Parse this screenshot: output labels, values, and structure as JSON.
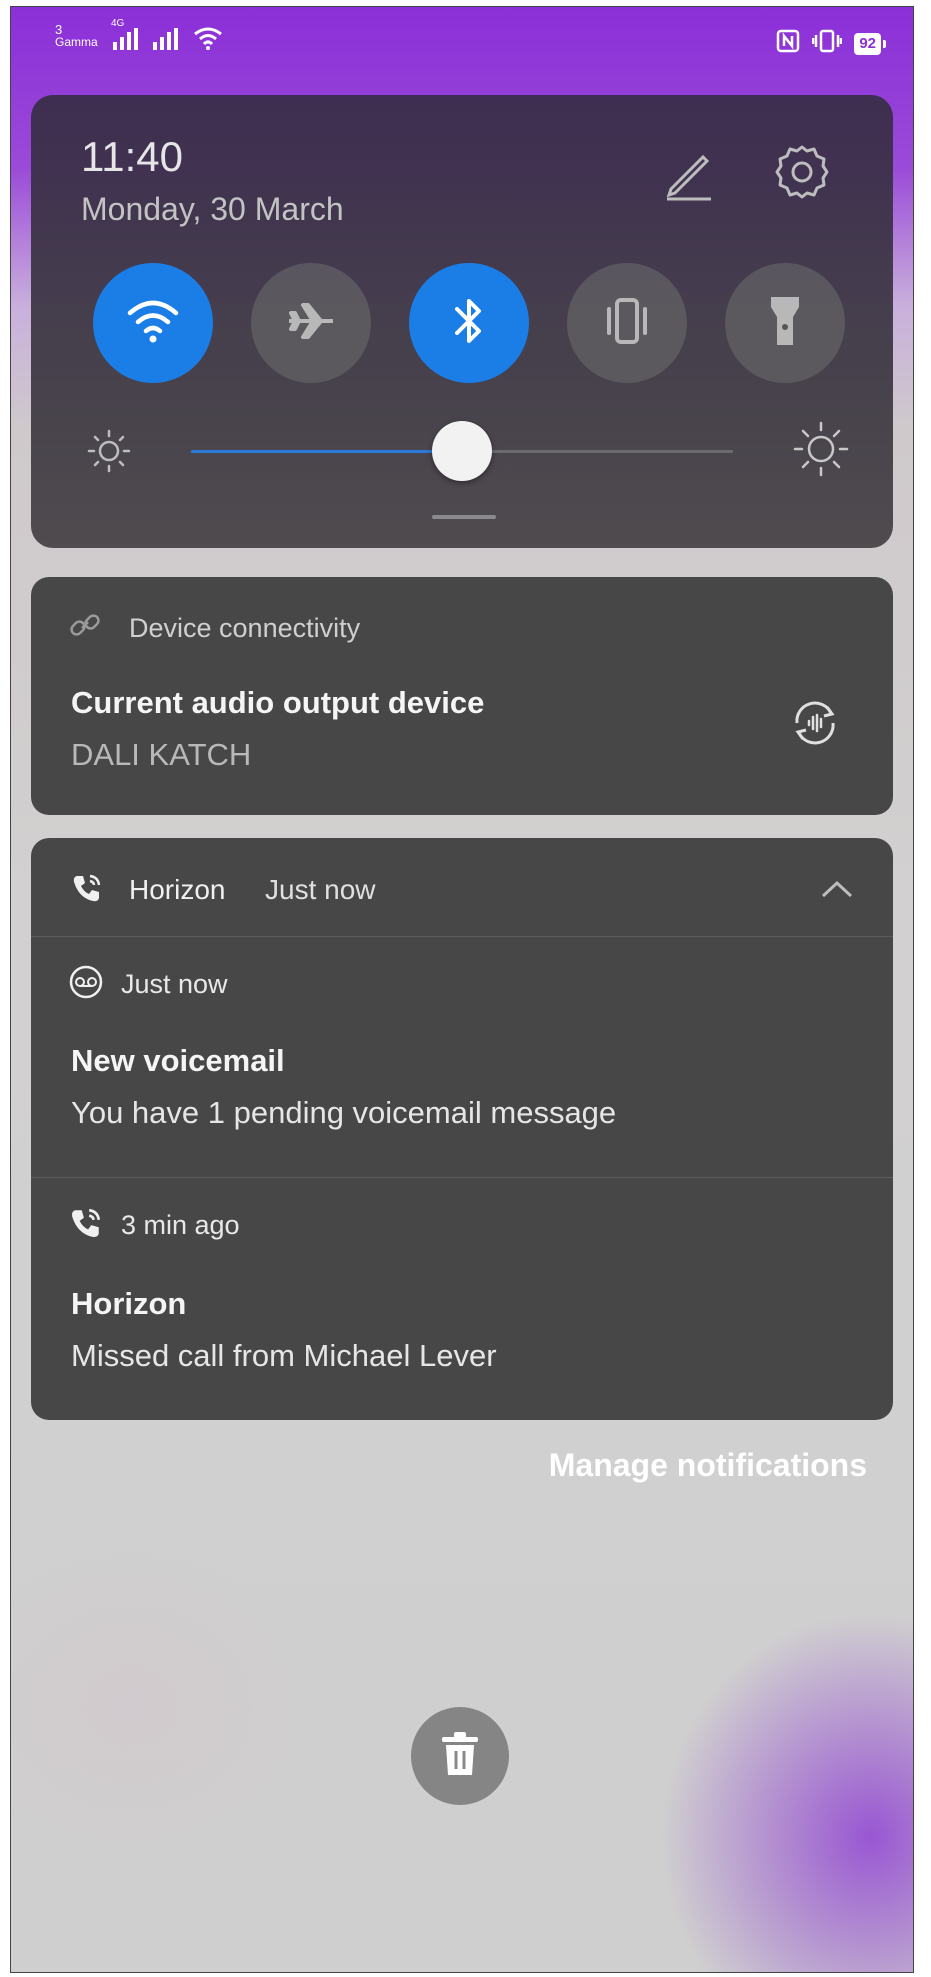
{
  "status_bar": {
    "carrier_number": "3",
    "carrier_name": "Gamma",
    "network_type": "4G",
    "battery_level": "92",
    "icons_left": [
      "signal-icon",
      "signal-icon",
      "wifi-icon"
    ],
    "icons_right": [
      "nfc-icon",
      "vibrate-icon",
      "battery-icon"
    ]
  },
  "quick_settings": {
    "time": "11:40",
    "date": "Monday, 30 March",
    "toggles": [
      {
        "name": "wifi",
        "icon": "wifi-icon",
        "on": true
      },
      {
        "name": "airplane",
        "icon": "airplane-icon",
        "on": false
      },
      {
        "name": "bluetooth",
        "icon": "bluetooth-icon",
        "on": true
      },
      {
        "name": "vibrate",
        "icon": "vibrate-icon",
        "on": false
      },
      {
        "name": "flashlight",
        "icon": "flashlight-icon",
        "on": false
      }
    ],
    "brightness_level": 0.5
  },
  "device_connectivity": {
    "header": "Device connectivity",
    "title": "Current audio output device",
    "device": "DALI KATCH"
  },
  "horizon_group": {
    "app_name": "Horizon",
    "time": "Just now",
    "notifications": [
      {
        "icon": "voicemail-icon",
        "time": "Just now",
        "title": "New voicemail",
        "body": "You have 1 pending voicemail message"
      },
      {
        "icon": "missed-call-icon",
        "time": "3 min ago",
        "title": "Horizon",
        "body": "Missed call from Michael Lever"
      }
    ]
  },
  "footer": {
    "manage_label": "Manage notifications"
  },
  "colors": {
    "accent_blue": "#1b7ee6",
    "gradient_top": "#8b2fd8",
    "card_bg": "#424242"
  }
}
